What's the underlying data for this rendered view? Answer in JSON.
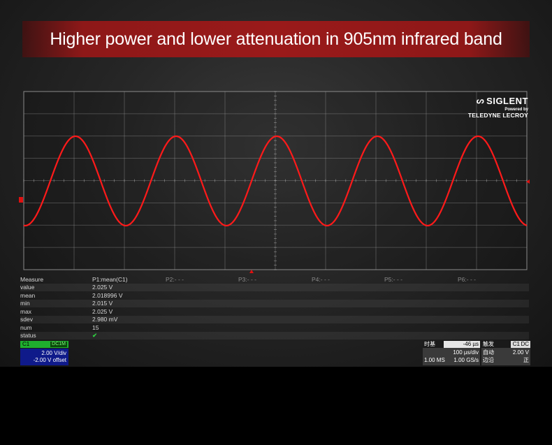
{
  "banner": {
    "title": "Higher power and lower attenuation in 905nm infrared band"
  },
  "logo": {
    "brand": "SIGLENT",
    "powered": "Powered by",
    "partner": "TELEDYNE LECROY"
  },
  "waveform": {
    "color": "#ff1a1a",
    "cycles": 5,
    "shape": "sine"
  },
  "measure": {
    "header": [
      "Measure",
      "P1:mean(C1)",
      "P2:- - -",
      "P3:- - -",
      "P4:- - -",
      "P5:- - -",
      "P6:- - -"
    ],
    "rows": [
      {
        "label": "value",
        "p1": "2.025 V"
      },
      {
        "label": "mean",
        "p1": "2.018996 V"
      },
      {
        "label": "min",
        "p1": "2.015 V"
      },
      {
        "label": "max",
        "p1": "2.025 V"
      },
      {
        "label": "sdev",
        "p1": "2.980 mV"
      },
      {
        "label": "num",
        "p1": "15"
      },
      {
        "label": "status",
        "p1": "✔"
      }
    ]
  },
  "channel": {
    "name": "C1",
    "coupling": "DC1M",
    "vdiv": "2.00 V/div",
    "offset": "-2.00 V offset",
    "color": "#1fae2e"
  },
  "timebase": {
    "title": "时基",
    "delay": "-46 µs",
    "tdiv": "100 µs/div",
    "points": "1.00 MS",
    "rate": "1.00 GS/s"
  },
  "trigger": {
    "title": "触发",
    "source": "C1",
    "coupling": "DC",
    "mode": "自动",
    "level": "2.00 V",
    "slope_label": "边沿",
    "slope": "正"
  }
}
